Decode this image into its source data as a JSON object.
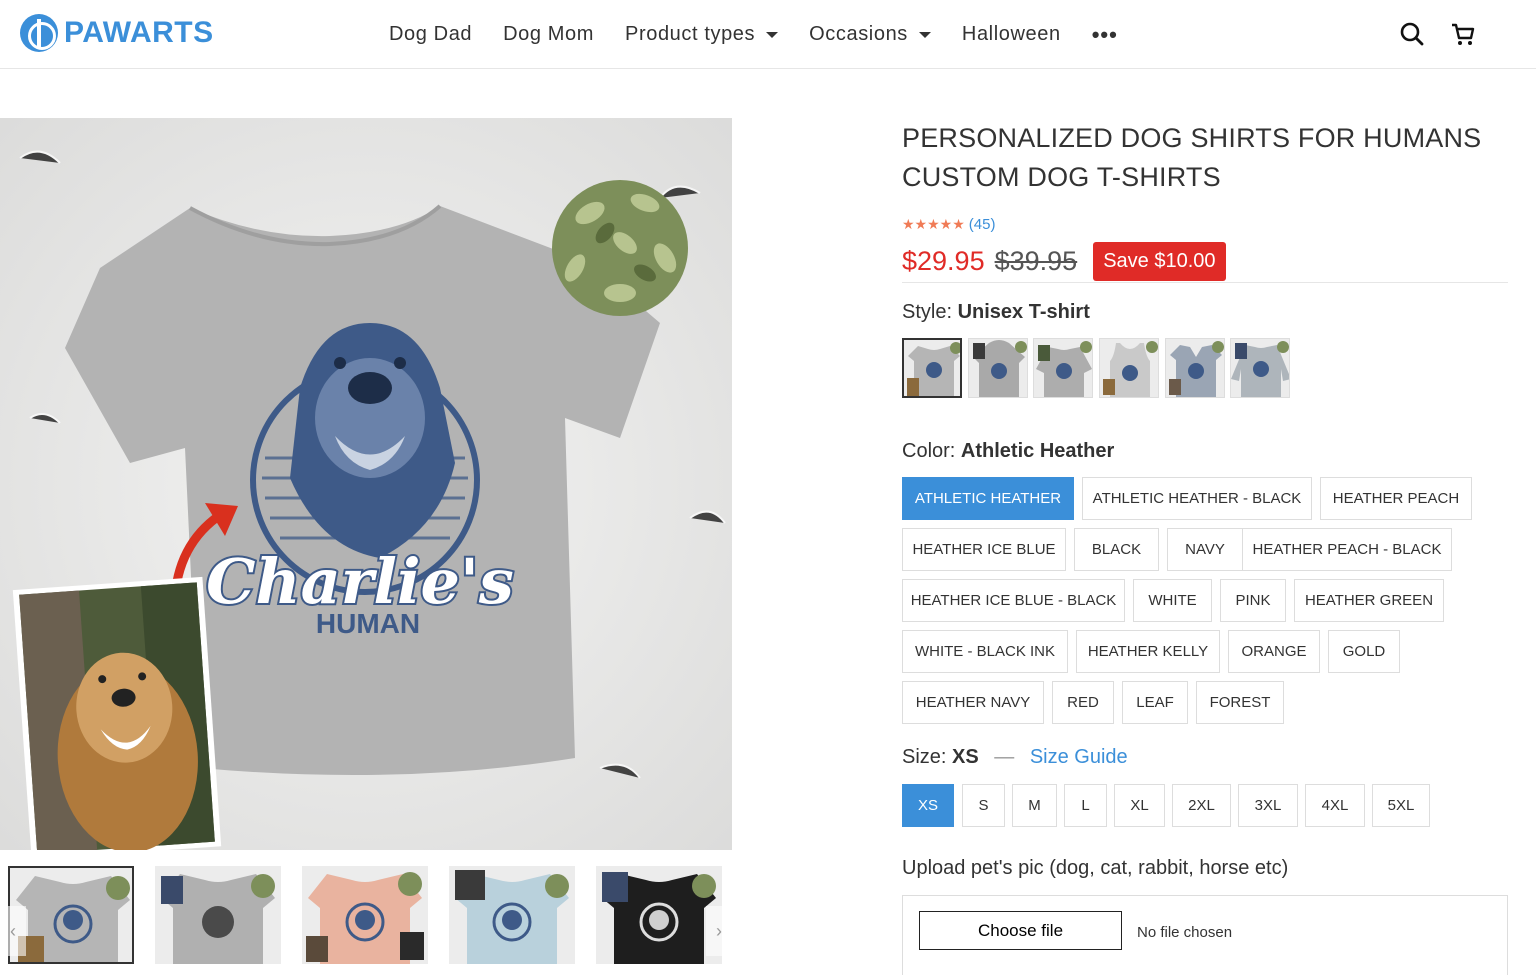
{
  "header": {
    "logo": "PAWARTS",
    "nav": [
      {
        "label": "Dog Dad",
        "dropdown": false
      },
      {
        "label": "Dog Mom",
        "dropdown": false
      },
      {
        "label": "Product types",
        "dropdown": true
      },
      {
        "label": "Occasions",
        "dropdown": true
      },
      {
        "label": "Halloween",
        "dropdown": false
      }
    ],
    "more": "•••"
  },
  "gallery": {
    "main_text_1": "Charlie's",
    "main_text_2": "HUMAN",
    "thumbnails": [
      {
        "color": "#b5b5b5",
        "active": true
      },
      {
        "color": "#b0b0b0",
        "active": false
      },
      {
        "color": "#e9b39f",
        "active": false
      },
      {
        "color": "#b9d1dc",
        "active": false
      },
      {
        "color": "#1e1e1e",
        "active": false
      }
    ]
  },
  "product": {
    "title_line1": "PERSONALIZED DOG SHIRTS FOR HUMANS",
    "title_line2": "CUSTOM DOG T-SHIRTS",
    "stars": "★★★★★",
    "review_count": "(45)",
    "price": "$29.95",
    "old_price": "$39.95",
    "save": "Save $10.00",
    "style_label": "Style:",
    "style_value": "Unisex T-shirt",
    "color_label": "Color:",
    "color_value": "Athletic Heather",
    "colors": [
      "ATHLETIC HEATHER",
      "ATHLETIC HEATHER - BLACK",
      "HEATHER PEACH",
      "HEATHER ICE BLUE",
      "BLACK",
      "NAVY",
      "HEATHER PEACH - BLACK",
      "HEATHER ICE BLUE - BLACK",
      "WHITE",
      "PINK",
      "HEATHER GREEN",
      "WHITE - BLACK INK",
      "HEATHER KELLY",
      "ORANGE",
      "GOLD",
      "HEATHER NAVY",
      "RED",
      "LEAF",
      "FOREST"
    ],
    "size_label": "Size:",
    "size_value": "XS",
    "size_dash": "—",
    "size_guide": "Size Guide",
    "sizes": [
      "XS",
      "S",
      "M",
      "L",
      "XL",
      "2XL",
      "3XL",
      "4XL",
      "5XL"
    ],
    "upload_label": "Upload pet's pic (dog, cat, rabbit, horse etc)",
    "choose_file": "Choose file",
    "no_file": "No file chosen"
  },
  "colors": {
    "accent": "#3b8fd9",
    "sale": "#e02b27",
    "shirt_navy": "#3e5a88"
  }
}
